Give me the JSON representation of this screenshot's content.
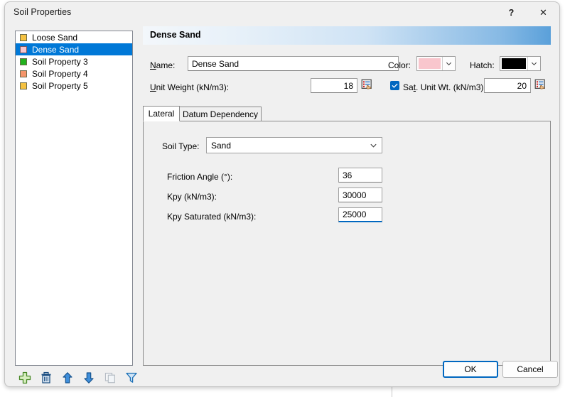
{
  "window": {
    "title": "Soil Properties",
    "help_label": "?",
    "close_label": "✕"
  },
  "soil_list": {
    "items": [
      {
        "label": "Loose Sand",
        "color": "#f5c242",
        "selected": false
      },
      {
        "label": "Dense Sand",
        "color": "#f9c6cd",
        "selected": true
      },
      {
        "label": "Soil Property 3",
        "color": "#22b21e",
        "selected": false
      },
      {
        "label": "Soil Property 4",
        "color": "#f5956a",
        "selected": false
      },
      {
        "label": "Soil Property 5",
        "color": "#f5c242",
        "selected": false
      }
    ]
  },
  "list_toolbar": {
    "items": [
      {
        "name": "add-icon",
        "title": "Add"
      },
      {
        "name": "delete-icon",
        "title": "Delete"
      },
      {
        "name": "move-up-icon",
        "title": "Move Up"
      },
      {
        "name": "move-down-icon",
        "title": "Move Down"
      },
      {
        "name": "duplicate-icon",
        "title": "Duplicate"
      },
      {
        "name": "filter-icon",
        "title": "Filter"
      }
    ]
  },
  "details": {
    "header_title": "Dense Sand",
    "name_label": "Name:",
    "name_value": "Dense Sand",
    "color_label": "Color:",
    "color_value": "#f9c6cd",
    "hatch_label": "Hatch:",
    "hatch_value": "#000000",
    "unit_weight_label": "Unit Weight (kN/m3):",
    "unit_weight_value": "18",
    "sat_unit_weight_label": "Sat. Unit Wt. (kN/m3):",
    "sat_unit_weight_value": "20",
    "sat_unit_weight_checked": true
  },
  "tabs": [
    {
      "label": "Lateral",
      "active": true
    },
    {
      "label": "Datum Dependency",
      "active": false
    }
  ],
  "lateral": {
    "soil_type_label": "Soil Type:",
    "soil_type_value": "Sand",
    "fields": [
      {
        "label": "Friction Angle (°):",
        "value": "36",
        "focused": false
      },
      {
        "label": "Kpy (kN/m3):",
        "value": "30000",
        "focused": false
      },
      {
        "label": "Kpy Saturated (kN/m3):",
        "value": "25000",
        "focused": true
      }
    ]
  },
  "footer": {
    "ok_label": "OK",
    "cancel_label": "Cancel"
  },
  "theme": {
    "accent": "#0067c0",
    "selection": "#0078d7",
    "dialog_bg": "#f0f0f0",
    "field_bg": "#ffffff"
  }
}
